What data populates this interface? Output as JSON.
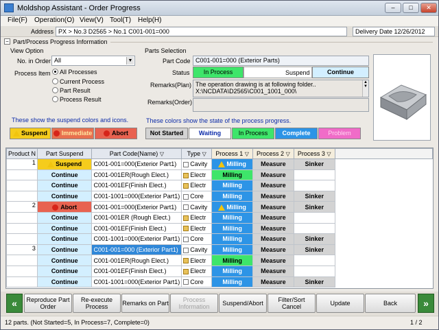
{
  "window": {
    "title": "Moldshop Assistant - Order Progress",
    "min": "–",
    "max": "□",
    "close": "✕"
  },
  "menu": [
    "File(F)",
    "Operation(O)",
    "View(V)",
    "Tool(T)",
    "Help(H)"
  ],
  "address": {
    "label": "Address",
    "path": "PX > No.3 D2565 > No.1 C001-001=000",
    "delivery": "Delivery Date 12/26/2012"
  },
  "section": {
    "title": "Part/Process Progress Information"
  },
  "view_option": {
    "title": "View Option",
    "order_label": "No. in Order",
    "order_value": "All",
    "process_item_label": "Process Item",
    "radios": [
      "All Processes",
      "Current Process",
      "Part Result",
      "Process Result"
    ],
    "selected": 0,
    "note": "These show the suspend colors and icons.",
    "legend": [
      {
        "label": "Suspend",
        "color": "#f5cc1c"
      },
      {
        "label": "Immediate",
        "color": "#e8704f"
      },
      {
        "label": "Abort",
        "color": "#e86250"
      }
    ]
  },
  "parts_selection": {
    "title": "Parts Selection",
    "part_code_label": "Part Code",
    "part_code": "C001-001=000 (Exterior Parts)",
    "status_label": "Status",
    "status": "In Process",
    "suspend_label": "Suspend",
    "suspend_value": "Continue",
    "remarks_plan_label": "Remarks(Plan)",
    "remarks_plan": "The operation drawing is at following folder..\nX:\\NCDATA\\D2565\\C001_1001_000\\",
    "remarks_order_label": "Remarks(Order)",
    "remarks_order": "",
    "note": "These colors show the state of the process progress.",
    "legend": [
      {
        "label": "Not Started",
        "color": "#d3d3d3"
      },
      {
        "label": "Waiting",
        "color": "#ffffff"
      },
      {
        "label": "In Process",
        "color": "#3ee56a"
      },
      {
        "label": "Complete",
        "color": "#2d94e6"
      },
      {
        "label": "Problem",
        "color": "#f06cc8"
      }
    ]
  },
  "grid": {
    "headers": [
      "Product N",
      "Part Suspend",
      "Part Code(Name)",
      "Type",
      "Process 1",
      "Process 2",
      "Process 3"
    ],
    "rows": [
      {
        "pn": "1",
        "sus": "Suspend",
        "sc": "ys",
        "code": "C001-001=000(Exterior Part1)",
        "type": "Cavity",
        "p1": "Milling",
        "c1": "Milling",
        "w1": true,
        "p2": "Measure",
        "p3": "Sinker"
      },
      {
        "pn": "",
        "sus": "Continue",
        "sc": "",
        "code": "C001-001ER(Rough Elect.)",
        "type": "Electr",
        "p1": "Milling",
        "c1": "MillingG",
        "p2": "Measure",
        "p3": ""
      },
      {
        "pn": "",
        "sus": "Continue",
        "sc": "",
        "code": "C001-001EF(Finish Elect.)",
        "type": "Electr",
        "p1": "Milling",
        "c1": "Milling",
        "p2": "Measure",
        "p3": ""
      },
      {
        "pn": "",
        "sus": "Continue",
        "sc": "",
        "code": "C001-1001=000(Exterior Part1)",
        "type": "Core",
        "p1": "Milling",
        "c1": "Milling",
        "p2": "Measure",
        "p3": "Sinker"
      },
      {
        "pn": "2",
        "sus": "Abort",
        "sc": "rs",
        "code": "C001-001=000(Exterior Part1)",
        "type": "Cavity",
        "p1": "Milling",
        "c1": "Milling",
        "w1": true,
        "p2": "Measure",
        "p3": "Sinker"
      },
      {
        "pn": "",
        "sus": "Continue",
        "sc": "",
        "code": "C001-001ER (Rough Elect.)",
        "type": "Electr",
        "p1": "Milling",
        "c1": "Milling",
        "p2": "Measure",
        "p3": ""
      },
      {
        "pn": "",
        "sus": "Continue",
        "sc": "",
        "code": "C001-001EF(Finish Elect.)",
        "type": "Electr",
        "p1": "Milling",
        "c1": "Milling",
        "p2": "Measure",
        "p3": ""
      },
      {
        "pn": "",
        "sus": "Continue",
        "sc": "",
        "code": "C001-1001=000(Exterior Part1)",
        "type": "Core",
        "p1": "Milling",
        "c1": "Milling",
        "p2": "Measure",
        "p3": "Sinker"
      },
      {
        "pn": "3",
        "sus": "Continue",
        "sc": "",
        "code": "C001-001=000 (Exterior Part1)",
        "type": "Cavity",
        "p1": "Milling",
        "c1": "Milling",
        "p2": "Measure",
        "p3": "Sinker",
        "sel": true
      },
      {
        "pn": "",
        "sus": "Continue",
        "sc": "",
        "code": "C001-001ER(Rough Elect.)",
        "type": "Electr",
        "p1": "Milling",
        "c1": "MillingG",
        "p2": "Measure",
        "p3": ""
      },
      {
        "pn": "",
        "sus": "Continue",
        "sc": "",
        "code": "C001-001EF(Finish Elect.)",
        "type": "Electr",
        "p1": "Milling",
        "c1": "Milling",
        "p2": "Measure",
        "p3": ""
      },
      {
        "pn": "",
        "sus": "Continue",
        "sc": "",
        "code": "C001-1001=000(Exterior Part1)",
        "type": "Core",
        "p1": "Milling",
        "c1": "Milling",
        "p2": "Measure",
        "p3": "Sinker"
      }
    ]
  },
  "buttons": [
    {
      "label": "Reproduce Part Order",
      "disabled": false
    },
    {
      "label": "Re-execute Process",
      "disabled": false
    },
    {
      "label": "Remarks on Part",
      "disabled": false
    },
    {
      "label": "Process Information",
      "disabled": true
    },
    {
      "label": "Suspend/Abort",
      "disabled": false
    },
    {
      "label": "Filter/Sort Cancel",
      "disabled": false
    },
    {
      "label": "Update",
      "disabled": false
    },
    {
      "label": "Back",
      "disabled": false
    }
  ],
  "nav": {
    "prev": "«",
    "next": "»"
  },
  "status": {
    "summary": "12 parts.   (Not Started=5,  In Process=7,  Complete=0)",
    "page": "1 / 2"
  }
}
